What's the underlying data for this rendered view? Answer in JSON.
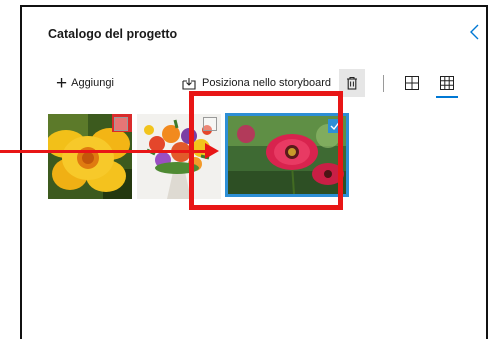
{
  "panel": {
    "title": "Catalogo del progetto"
  },
  "toolbar": {
    "add_label": "Aggiungi",
    "place_label": "Posiziona nello storyboard"
  },
  "thumbnails": [
    {
      "subject": "yellow flower",
      "selected": false
    },
    {
      "subject": "flower bouquet",
      "selected": false
    },
    {
      "subject": "red gerbera flowers",
      "selected": true
    }
  ],
  "icons": {
    "collapse": "chevron-left-icon",
    "add": "plus-icon",
    "place": "storyboard-place-icon",
    "delete": "trash-icon",
    "view_large": "grid-large-icon",
    "view_small": "grid-small-icon",
    "check": "checkmark-icon"
  },
  "colors": {
    "accent": "#0078d4",
    "selection": "#2d8fd6",
    "callout": "#e81616"
  }
}
